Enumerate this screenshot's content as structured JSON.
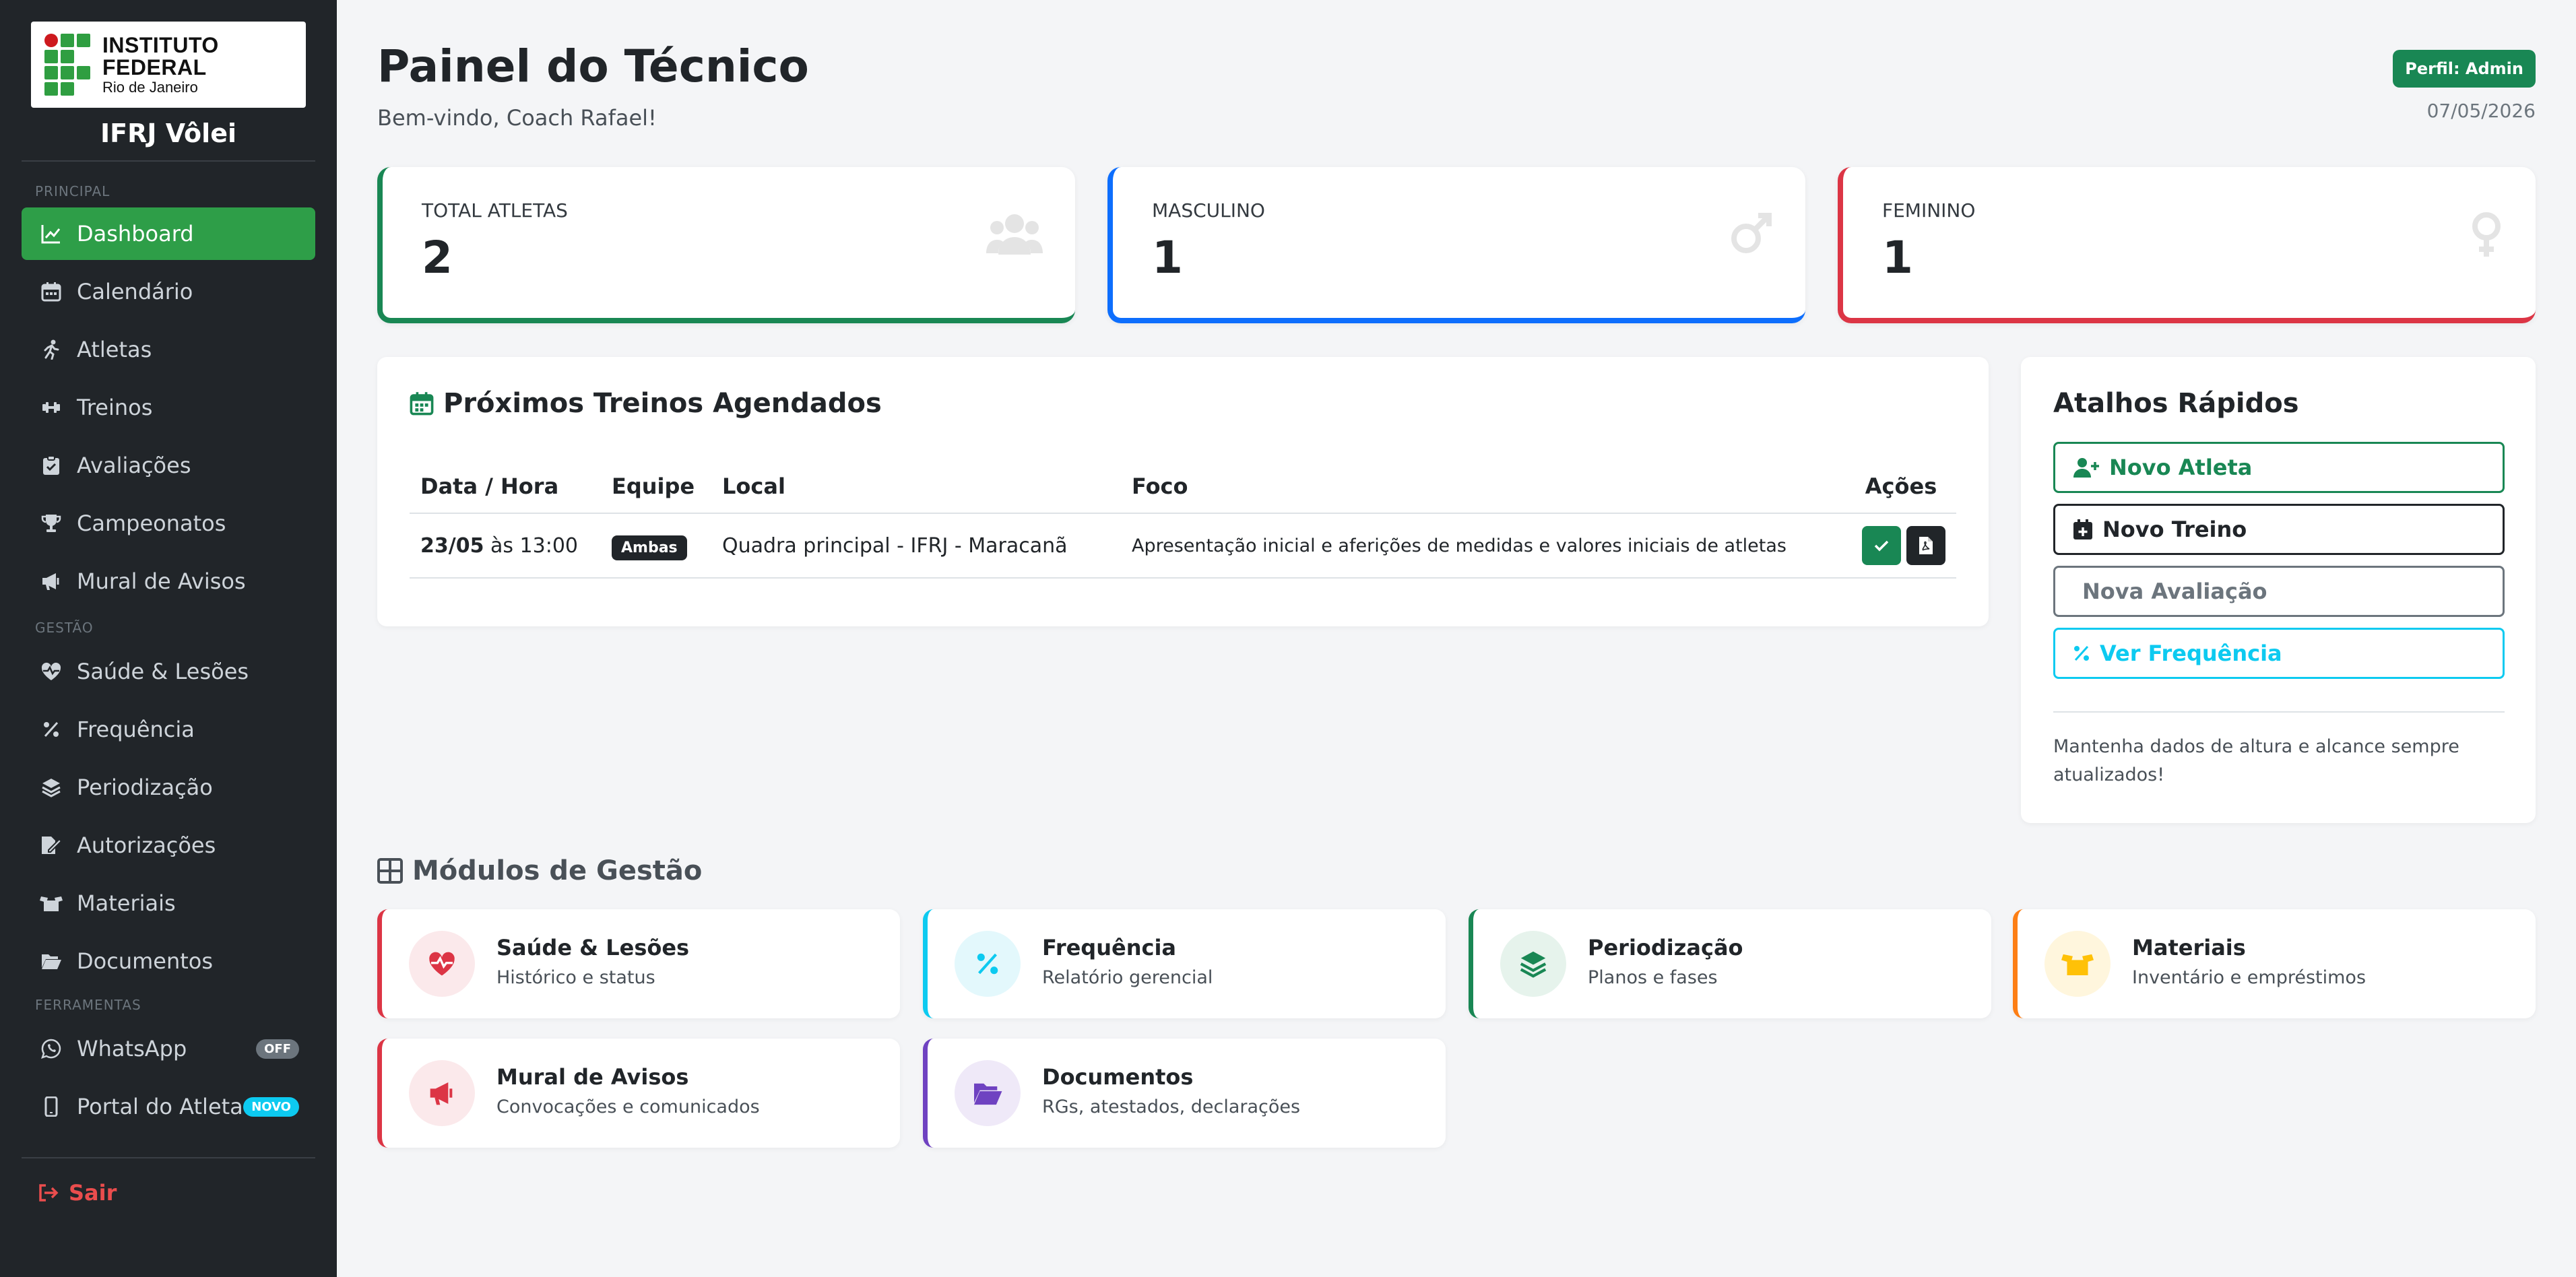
{
  "sidebar": {
    "logo_line1": "INSTITUTO FEDERAL",
    "logo_line2": "Rio de Janeiro",
    "brand": "IFRJ Vôlei",
    "sections": {
      "principal": "PRINCIPAL",
      "gestao": "GESTÃO",
      "ferramentas": "FERRAMENTAS"
    },
    "items": [
      {
        "label": "Dashboard",
        "icon": "chart-line-icon"
      },
      {
        "label": "Calendário",
        "icon": "calendar-icon"
      },
      {
        "label": "Atletas",
        "icon": "running-icon"
      },
      {
        "label": "Treinos",
        "icon": "dumbbell-icon"
      },
      {
        "label": "Avaliações",
        "icon": "clipboard-check-icon"
      },
      {
        "label": "Campeonatos",
        "icon": "trophy-icon"
      },
      {
        "label": "Mural de Avisos",
        "icon": "megaphone-icon"
      },
      {
        "label": "Saúde & Lesões",
        "icon": "heart-pulse-icon"
      },
      {
        "label": "Frequência",
        "icon": "percent-icon"
      },
      {
        "label": "Periodização",
        "icon": "layers-icon"
      },
      {
        "label": "Autorizações",
        "icon": "file-signature-icon"
      },
      {
        "label": "Materiais",
        "icon": "box-open-icon"
      },
      {
        "label": "Documentos",
        "icon": "folder-open-icon"
      },
      {
        "label": "WhatsApp",
        "icon": "whatsapp-icon",
        "badge": "OFF"
      },
      {
        "label": "Portal do Atleta",
        "icon": "mobile-icon",
        "badge": "NOVO"
      }
    ],
    "logout": "Sair"
  },
  "header": {
    "title": "Painel do Técnico",
    "welcome": "Bem-vindo, Coach Rafael!",
    "role_badge": "Perfil: Admin",
    "date": "07/05/2026"
  },
  "stats": [
    {
      "label": "TOTAL ATLETAS",
      "value": "2",
      "color": "#198754",
      "icon": "users-icon"
    },
    {
      "label": "MASCULINO",
      "value": "1",
      "color": "#0d6efd",
      "icon": "mars-icon"
    },
    {
      "label": "FEMININO",
      "value": "1",
      "color": "#dc3545",
      "icon": "venus-icon"
    }
  ],
  "schedule": {
    "title": "Próximos Treinos Agendados",
    "columns": [
      "Data / Hora",
      "Equipe",
      "Local",
      "Foco",
      "Ações"
    ],
    "rows": [
      {
        "date": "23/05",
        "time": "às 13:00",
        "team": "Ambas",
        "local": "Quadra principal - IFRJ - Maracanã",
        "focus": "Apresentação inicial e aferições de medidas e valores iniciais de atletas"
      }
    ]
  },
  "shortcuts": {
    "title": "Atalhos Rápidos",
    "buttons": [
      {
        "label": "Novo Atleta",
        "color": "#198754",
        "icon": "user-plus-icon"
      },
      {
        "label": "Novo Treino",
        "color": "#212529",
        "icon": "calendar-plus-icon"
      },
      {
        "label": "Nova Avaliação",
        "color": "#6c757d",
        "icon": ""
      },
      {
        "label": "Ver Frequência",
        "color": "#0dcaf0",
        "icon": "percent-icon"
      }
    ],
    "note": "Mantenha dados de altura e alcance sempre atualizados!"
  },
  "modules": {
    "title": "Módulos de Gestão",
    "items": [
      {
        "title": "Saúde & Lesões",
        "subtitle": "Histórico e status",
        "color": "#dc3545",
        "bg": "#fbe9eb",
        "icon": "heart-pulse-icon"
      },
      {
        "title": "Frequência",
        "subtitle": "Relatório gerencial",
        "color": "#0dcaf0",
        "bg": "#e3f8fc",
        "icon": "percent-icon"
      },
      {
        "title": "Periodização",
        "subtitle": "Planos e fases",
        "color": "#198754",
        "bg": "#e6f3ec",
        "icon": "layers-icon"
      },
      {
        "title": "Materiais",
        "subtitle": "Inventário e empréstimos",
        "color": "#fd7e14",
        "bg": "#fff6dd",
        "icon": "box-open-icon"
      },
      {
        "title": "Mural de Avisos",
        "subtitle": "Convocações e comunicados",
        "color": "#dc3545",
        "bg": "#fbe9eb",
        "icon": "megaphone-icon"
      },
      {
        "title": "Documentos",
        "subtitle": "RGs, atestados, declarações",
        "color": "#6f42c1",
        "bg": "#efe9f8",
        "icon": "folder-open-icon"
      }
    ]
  }
}
